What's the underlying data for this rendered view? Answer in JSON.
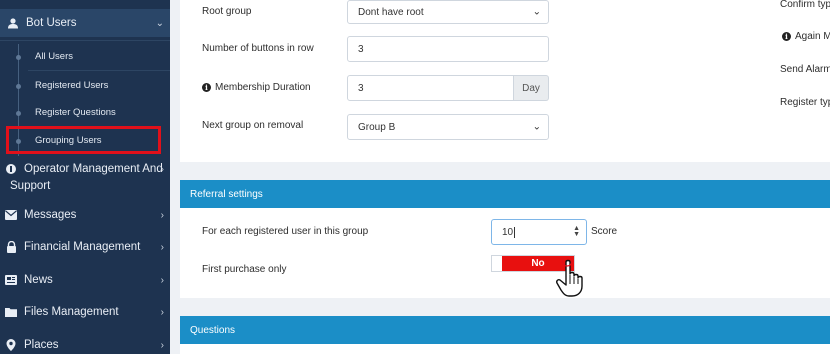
{
  "sidebar": {
    "bot_users": "Bot Users",
    "sub_items": [
      "All Users",
      "Registered Users",
      "Register Questions",
      "Grouping Users"
    ],
    "operator_management": "Operator Management And",
    "operator_management_2": "Support",
    "messages": "Messages",
    "financial": "Financial Management",
    "news": "News",
    "files": "Files Management",
    "places": "Places"
  },
  "form": {
    "root_group_label": "Root group",
    "root_group_value": "Dont have root",
    "buttons_row_label": "Number of buttons in row",
    "buttons_row_value": "3",
    "membership_label": "Membership Duration",
    "membership_value": "3",
    "membership_unit": "Day",
    "next_group_label": "Next group on removal",
    "next_group_value": "Group B"
  },
  "right_column": {
    "confirm": "Confirm typ",
    "again": "Again M",
    "send_alarm": "Send Alarm",
    "register": "Register typ"
  },
  "referral": {
    "title": "Referral settings",
    "each_user_label": "For each registered user in this group",
    "each_user_value": "10",
    "score_label": "Score",
    "first_purchase_label": "First purchase only",
    "toggle_value": "No"
  },
  "questions": {
    "title": "Questions"
  },
  "colors": {
    "sidebar_bg": "#1e3350",
    "section_header": "#1b8ec7",
    "highlight": "#e0101a",
    "toggle_off": "#e8100f"
  }
}
